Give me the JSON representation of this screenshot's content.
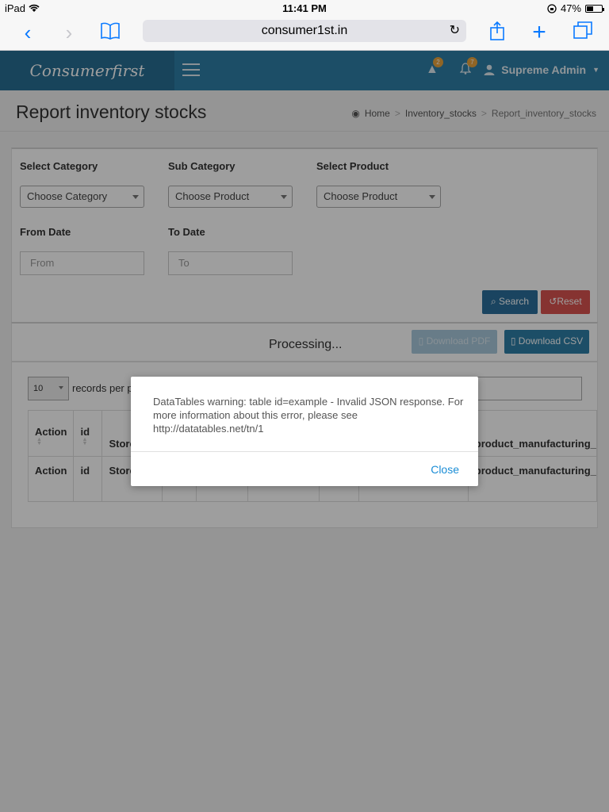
{
  "statusbar": {
    "device": "iPad",
    "time": "11:41 PM",
    "battery": "47%",
    "battery_level": 0.47
  },
  "safari": {
    "url": "consumer1st.in"
  },
  "header": {
    "brand": "Consumerfirst",
    "alert_count": "2",
    "notification_count": "7",
    "user": "Supreme Admin"
  },
  "page": {
    "title": "Report inventory stocks",
    "breadcrumb": [
      "Home",
      "Inventory_stocks",
      "Report_inventory_stocks"
    ]
  },
  "filters": {
    "category_label": "Select Category",
    "category_value": "Choose Category",
    "subcategory_label": "Sub Category",
    "subcategory_value": "Choose Product",
    "product_label": "Select Product",
    "product_value": "Choose Product",
    "from_label": "From Date",
    "from_placeholder": "From",
    "to_label": "To Date",
    "to_placeholder": "To",
    "search_btn": "Search",
    "reset_btn": "Reset"
  },
  "actions": {
    "processing": "Processing...",
    "download_pdf": "Download PDF",
    "download_csv": "Download CSV"
  },
  "table": {
    "length_value": "10",
    "length_text": "records per p",
    "headers": [
      "Action",
      "id",
      "Store Id",
      "",
      "",
      "",
      "",
      "",
      "product_manufacturing_"
    ]
  },
  "dialog": {
    "message": "DataTables warning: table id=example - Invalid JSON response. For more information about this error, please see http://datatables.net/tn/1",
    "close": "Close"
  },
  "colors": {
    "header_bg": "#2e7ea6",
    "search_btn": "#2a6f9b",
    "reset_btn": "#d9534f",
    "link": "#1a8dd6",
    "badge": "#e8a33c"
  }
}
